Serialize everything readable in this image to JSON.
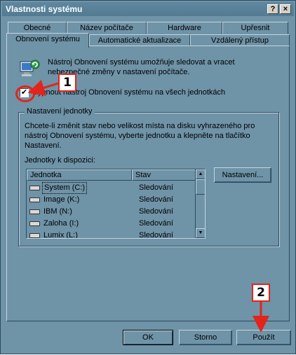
{
  "window": {
    "title": "Vlastnosti systému",
    "help_glyph": "?",
    "close_glyph": "×"
  },
  "tabs": {
    "row1": [
      "Obecné",
      "Název počítače",
      "Hardware",
      "Upřesnit"
    ],
    "row2": [
      "Obnovení systému",
      "Automatické aktualizace",
      "Vzdálený přístup"
    ]
  },
  "panel": {
    "description": "Nástroj Obnovení systému umožňuje sledovat a vracet nebezpečné změny v nastavení počítače.",
    "checkbox_label": "Vypnout nástroj Obnovení systému na všech jednotkách",
    "checkbox_mark": "✔",
    "group_title": "Nastavení jednotky",
    "group_text": "Chcete-li změnit stav nebo velikost místa na disku vyhrazeného pro nástroj Obnovení systému, vyberte jednotku a klepněte na tlačítko Nastavení.",
    "drives_label": "Jednotky k dispozici:",
    "columns": [
      "Jednotka",
      "Stav"
    ],
    "drives": [
      {
        "name": "System (C:)",
        "status": "Sledování"
      },
      {
        "name": "Image (K:)",
        "status": "Sledování"
      },
      {
        "name": "IBM (N:)",
        "status": "Sledování"
      },
      {
        "name": "Zaloha (I:)",
        "status": "Sledování"
      },
      {
        "name": "Lumix (L:)",
        "status": "Sledování"
      }
    ],
    "settings_button": "Nastavení..."
  },
  "footer": {
    "ok": "OK",
    "cancel": "Storno",
    "apply": "Použít"
  },
  "annotations": {
    "badge1": "1",
    "badge2": "2"
  },
  "colors": {
    "window_bg": "#6f93a7",
    "callout_red": "#e3241b"
  },
  "icons": {
    "app": "system-restore-icon",
    "drive": "hard-drive-icon"
  }
}
